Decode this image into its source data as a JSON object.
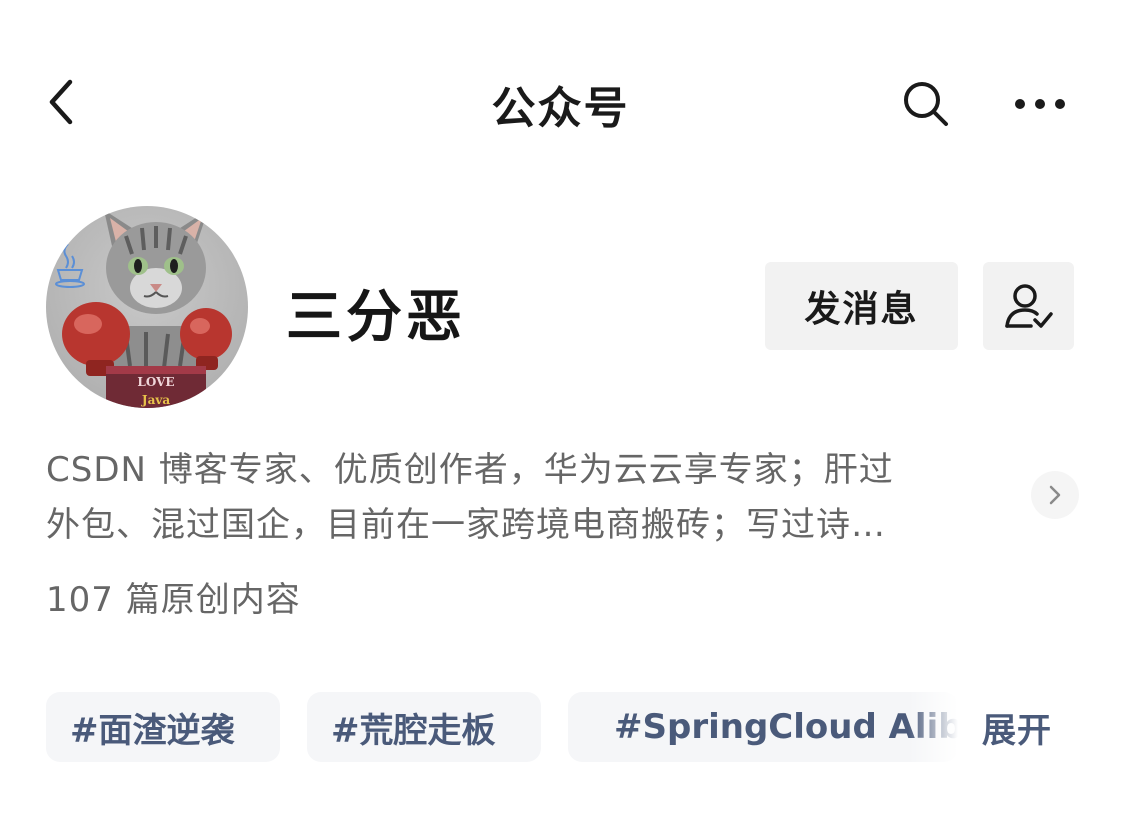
{
  "header": {
    "title": "公众号",
    "back_icon": "chevron-left-icon",
    "search_icon": "search-icon",
    "more_icon": "more-horizontal-icon"
  },
  "profile": {
    "name": "三分恶",
    "message_button": "发消息",
    "follow_icon": "user-check-icon",
    "avatar_texts": [
      "LOVE",
      "Java"
    ]
  },
  "description": {
    "line1": "CSDN 博客专家、优质创作者，华为云云享专家；肝过",
    "line2": "外包、混过国企，目前在一家跨境电商搬砖；写过诗…"
  },
  "stats": {
    "articles": "107 篇原创内容"
  },
  "tags": [
    {
      "label": "#面渣逆袭"
    },
    {
      "label": "#荒腔走板"
    },
    {
      "label": "#SpringCloud Alibaba"
    }
  ],
  "expand_label": "展开",
  "colors": {
    "tag_text": "#4a5a7a",
    "tag_bg": "#f5f6f8",
    "button_bg": "#f2f2f2",
    "secondary_text": "#666666"
  }
}
